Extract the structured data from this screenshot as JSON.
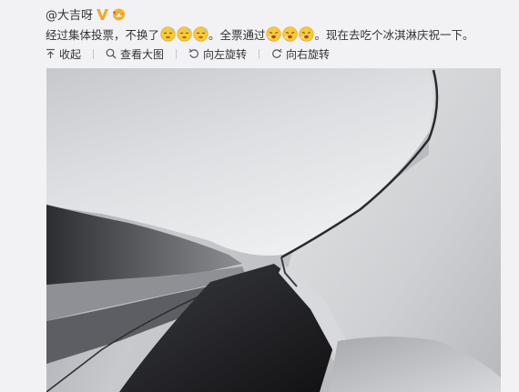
{
  "post": {
    "username": "@大吉呀",
    "text_part1": "经过集体投票，不换了",
    "text_part2": "。全票通过",
    "text_part3": "。现在去吃个冰淇淋庆祝一下。"
  },
  "toolbar": {
    "collapse_label": "收起",
    "view_large_label": "查看大图",
    "rotate_left_label": "向左旋转",
    "rotate_right_label": "向右旋转"
  },
  "icons": {
    "verified": "verified-v-icon",
    "member": "member-crown-icon",
    "emoji_group1": "sleepy-face-emoji",
    "emoji_group2": "yawn-face-emoji"
  },
  "colors": {
    "verified": "#f5a623",
    "text": "#333333",
    "background": "#f2f2f5"
  }
}
